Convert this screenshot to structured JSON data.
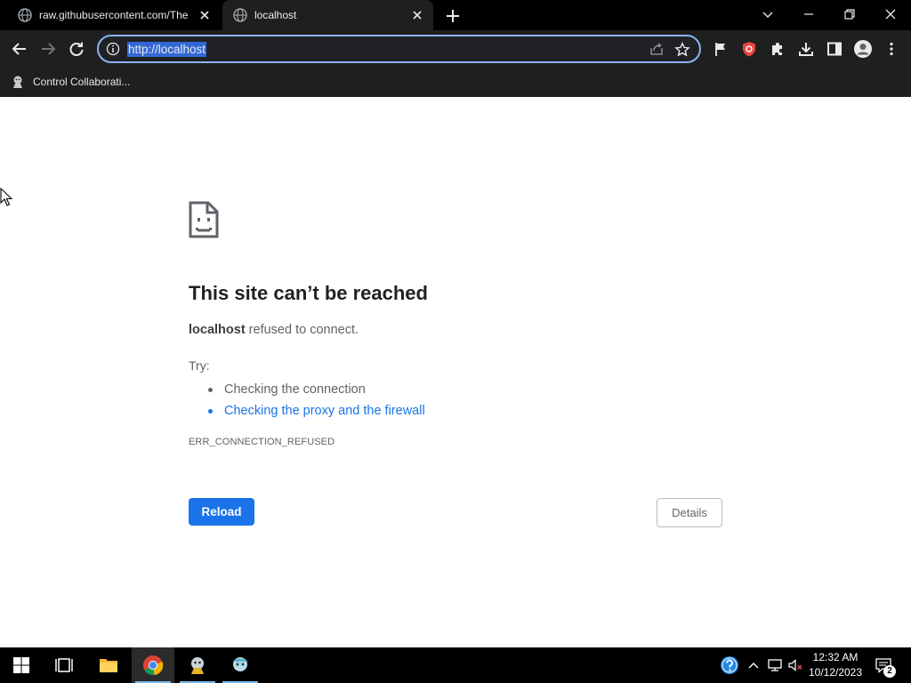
{
  "browser": {
    "tabs": [
      {
        "title": "raw.githubusercontent.com/The",
        "active": false
      },
      {
        "title": "localhost",
        "active": true
      }
    ],
    "address_bar": {
      "url": "http://localhost"
    },
    "bookmarks": [
      {
        "label": "Control Collaborati..."
      }
    ],
    "colors": {
      "omnibox_focus": "#8ab4f8",
      "selection": "#3367d6",
      "shield_extension": "#e8453c"
    }
  },
  "error_page": {
    "title": "This site can’t be reached",
    "host": "localhost",
    "description": " refused to connect.",
    "try_label": "Try:",
    "suggestions": [
      {
        "text": "Checking the connection",
        "link": false
      },
      {
        "text": "Checking the proxy and the firewall",
        "link": true
      }
    ],
    "error_code": "ERR_CONNECTION_REFUSED",
    "reload_label": "Reload",
    "details_label": "Details",
    "colors": {
      "primary": "#1a73e8",
      "text": "#5f6368",
      "title": "#202124"
    }
  },
  "taskbar": {
    "apps": [
      "start-icon",
      "task-view-icon",
      "file-explorer-icon",
      "chrome-icon",
      "app-icon-1",
      "app-icon-2"
    ],
    "active_app": "chrome-icon",
    "clock": {
      "time": "12:32 AM",
      "date": "10/12/2023"
    },
    "notification_count": "2"
  }
}
